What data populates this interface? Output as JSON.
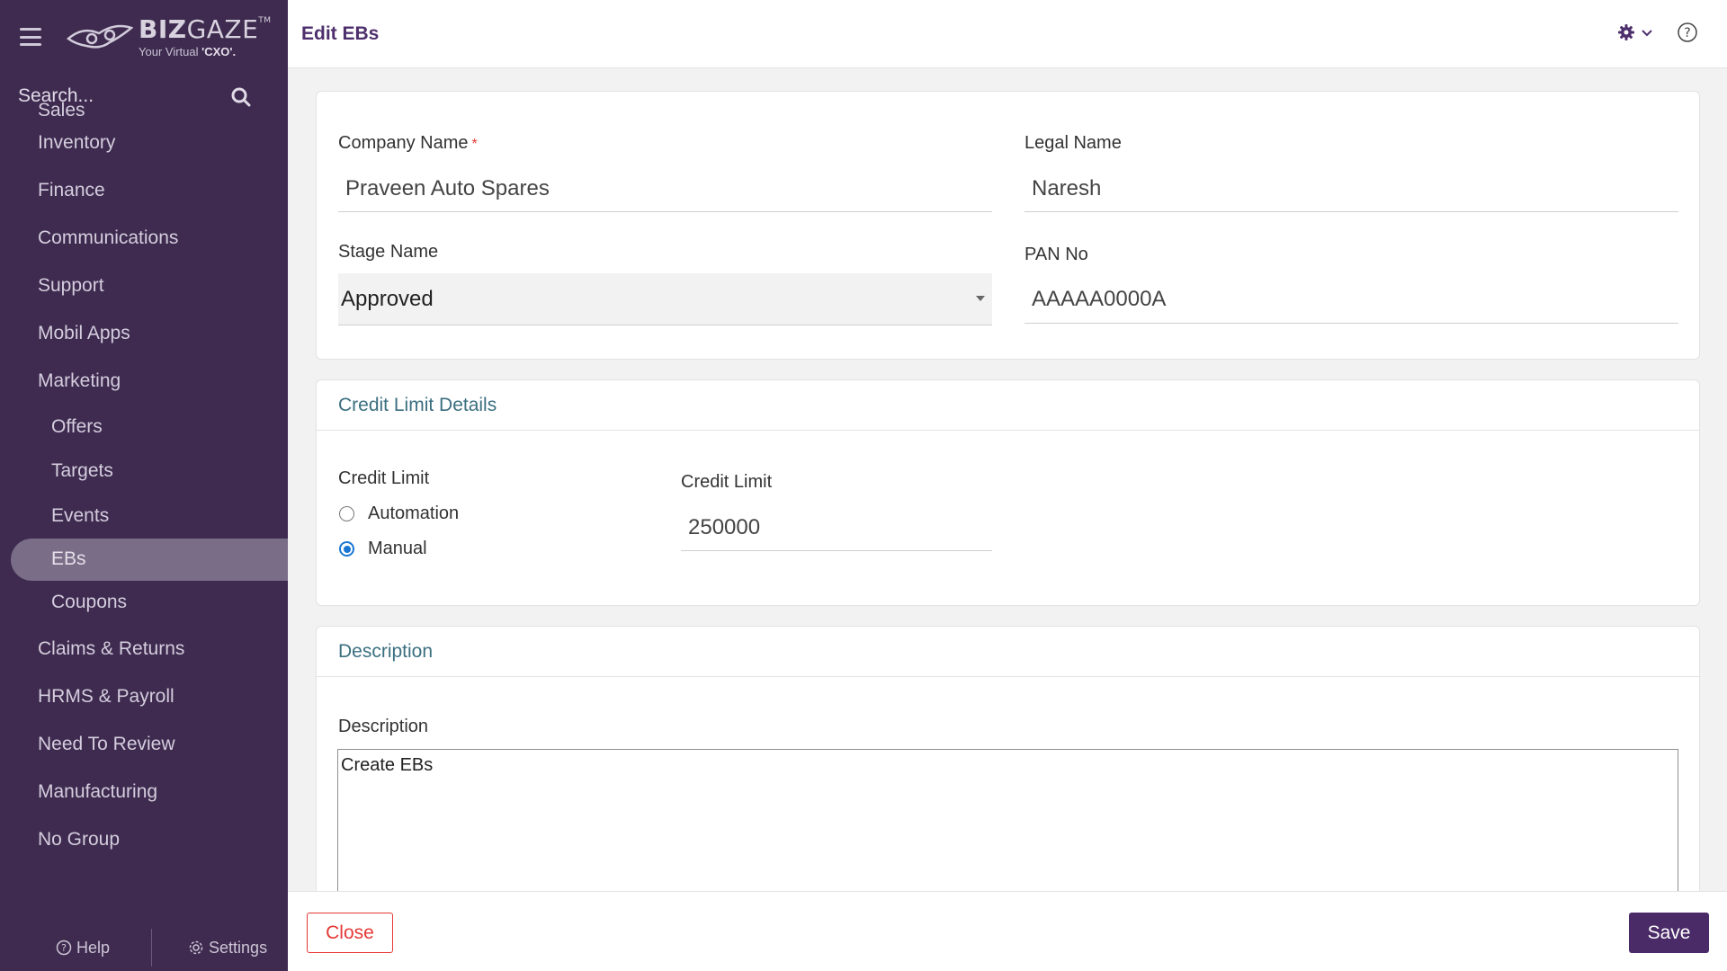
{
  "app": {
    "logo_title_bold": "BIZ",
    "logo_title_rest": "GAZE",
    "logo_tm": "TM",
    "logo_sub_prefix": "Your Virtual ",
    "logo_sub_bold": "'CXO'."
  },
  "sidebar": {
    "search_placeholder": "Search...",
    "partial_item": "Sales",
    "items": [
      {
        "label": "Inventory"
      },
      {
        "label": "Finance"
      },
      {
        "label": "Communications"
      },
      {
        "label": "Support"
      },
      {
        "label": "Mobil Apps"
      },
      {
        "label": "Marketing"
      }
    ],
    "sub_items": [
      {
        "label": "Offers"
      },
      {
        "label": "Targets"
      },
      {
        "label": "Events"
      },
      {
        "label": "EBs"
      },
      {
        "label": "Coupons"
      }
    ],
    "items_after": [
      {
        "label": "Claims & Returns"
      },
      {
        "label": "HRMS & Payroll"
      },
      {
        "label": "Need To Review"
      },
      {
        "label": "Manufacturing"
      },
      {
        "label": "No Group"
      }
    ],
    "footer": {
      "help": "Help",
      "settings": "Settings"
    }
  },
  "header": {
    "title": "Edit EBs"
  },
  "form": {
    "company_name": {
      "label": "Company Name",
      "required_mark": "*",
      "value": "Praveen Auto Spares"
    },
    "legal_name": {
      "label": "Legal Name",
      "value": "Naresh"
    },
    "stage_name": {
      "label": "Stage Name",
      "value": "Approved"
    },
    "pan_no": {
      "label": "PAN No",
      "value": "AAAAA0000A"
    }
  },
  "credit_section": {
    "title": "Credit Limit Details",
    "radio_label": "Credit Limit",
    "options": [
      {
        "label": "Automation",
        "checked": false
      },
      {
        "label": "Manual",
        "checked": true
      }
    ],
    "amount_label": "Credit Limit",
    "amount_value": "250000"
  },
  "description_section": {
    "title": "Description",
    "label": "Description",
    "value": "Create EBs"
  },
  "footer": {
    "close_label": "Close",
    "save_label": "Save"
  },
  "colors": {
    "brand": "#4a2a67",
    "sidebar_bg": "#3e2b4f",
    "danger": "#e53935",
    "radio_accent": "#1976d2"
  }
}
